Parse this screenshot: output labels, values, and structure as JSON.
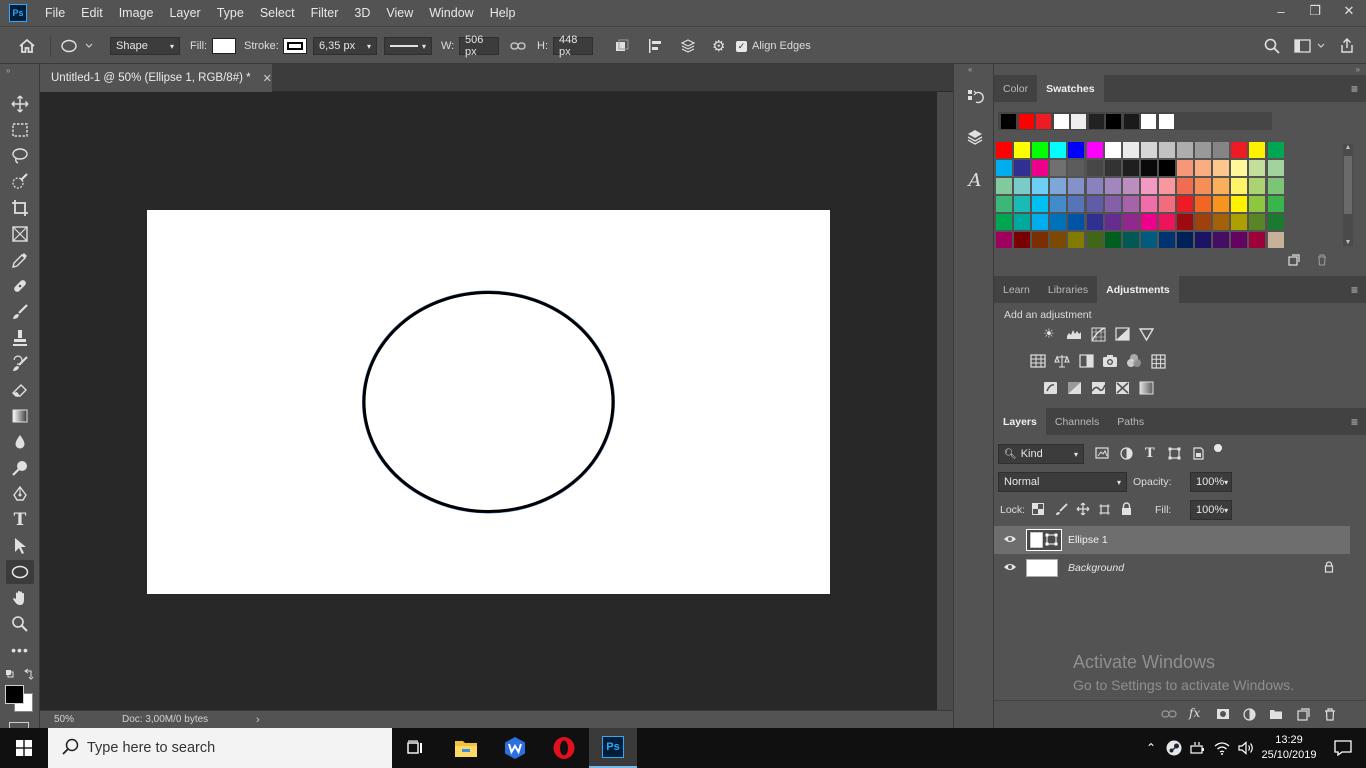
{
  "app": {
    "logo": "Ps",
    "menu": [
      "File",
      "Edit",
      "Image",
      "Layer",
      "Type",
      "Select",
      "Filter",
      "3D",
      "View",
      "Window",
      "Help"
    ],
    "window_controls": [
      "minimize-icon",
      "restore-icon",
      "close-icon"
    ]
  },
  "options": {
    "mode": "Shape",
    "fill_label": "Fill:",
    "stroke_label": "Stroke:",
    "stroke_width": "6,35 px",
    "w_label": "W:",
    "w_value": "506 px",
    "h_label": "H:",
    "h_value": "448 px",
    "align_edges": "Align Edges",
    "align_edges_checked": true
  },
  "document": {
    "tab_title": "Untitled-1 @ 50% (Ellipse 1, RGB/8#) *",
    "zoom": "50%",
    "doc_info": "Doc: 3,00M/0 bytes",
    "canvas_color": "#ffffff",
    "shape_stroke": "#000000",
    "shape_fill": "#ffffff"
  },
  "swatches_panel": {
    "tabs": [
      "Color",
      "Swatches"
    ],
    "active_tab": "Swatches",
    "recent": [
      "#000000",
      "#ff0000",
      "#ed1c24",
      "#ffffff",
      "#eeeeee",
      "#222222",
      "#000000",
      "#1a1a1a",
      "#ffffff",
      "#ffffff"
    ],
    "grid": [
      [
        "#ff0000",
        "#ffff00",
        "#00ff00",
        "#00ffff",
        "#0000ff",
        "#ff00ff",
        "#ffffff",
        "#ebebeb",
        "#d6d6d6",
        "#c2c2c2",
        "#adadad",
        "#999999",
        "#858585",
        "#ed1c24",
        "#fff200",
        "#00a651"
      ],
      [
        "#00aeef",
        "#2e3192",
        "#ec008c",
        "#707070",
        "#5c5c5c",
        "#474747",
        "#333333",
        "#1f1f1f",
        "#0a0a0a",
        "#000000",
        "#f7977a",
        "#fbad82",
        "#fdc68c",
        "#fff79a",
        "#c4df9b",
        "#a3d39c"
      ],
      [
        "#82ca9d",
        "#7accc8",
        "#6dcff6",
        "#7da7d9",
        "#8393ca",
        "#8882be",
        "#a187be",
        "#bc8dbf",
        "#f49ac2",
        "#f6989d",
        "#f26c4f",
        "#f68e56",
        "#fbaf5c",
        "#fff467",
        "#acd372",
        "#7cc576"
      ],
      [
        "#3bb878",
        "#1abbb4",
        "#00bff3",
        "#438ccb",
        "#5574b9",
        "#605ca8",
        "#855fa8",
        "#a763a9",
        "#ef6ea8",
        "#f16d7e",
        "#ed1c24",
        "#f26522",
        "#f7941d",
        "#fff200",
        "#8dc63f",
        "#39b54a"
      ],
      [
        "#00a651",
        "#00a99d",
        "#00aeef",
        "#0072bc",
        "#0054a5",
        "#2e3192",
        "#662d91",
        "#92278f",
        "#ec008c",
        "#ed145b",
        "#9e0b0f",
        "#a0410d",
        "#a36209",
        "#aba000",
        "#598527",
        "#1a7b30"
      ],
      [
        "#9e005d",
        "#790000",
        "#7b2e00",
        "#7d4900",
        "#827b00",
        "#406618",
        "#005e20",
        "#005952",
        "#005b7f",
        "#003471",
        "#002157",
        "#1b1464",
        "#440e62",
        "#630460",
        "#9e0039",
        "#c7b299"
      ]
    ]
  },
  "adjustments_panel": {
    "tabs": [
      "Learn",
      "Libraries",
      "Adjustments"
    ],
    "active_tab": "Adjustments",
    "heading": "Add an adjustment"
  },
  "layers_panel": {
    "tabs": [
      "Layers",
      "Channels",
      "Paths"
    ],
    "active_tab": "Layers",
    "filter_kind": "Kind",
    "blend_mode": "Normal",
    "opacity_label": "Opacity:",
    "opacity": "100%",
    "lock_label": "Lock:",
    "fill_label": "Fill:",
    "fill": "100%",
    "layers": [
      {
        "name": "Ellipse 1",
        "selected": true
      },
      {
        "name": "Background",
        "selected": false,
        "locked": true
      }
    ]
  },
  "activation": {
    "title": "Activate Windows",
    "subtitle": "Go to Settings to activate Windows."
  },
  "taskbar": {
    "search_placeholder": "Type here to search",
    "time": "13:29",
    "date": "25/10/2019"
  }
}
